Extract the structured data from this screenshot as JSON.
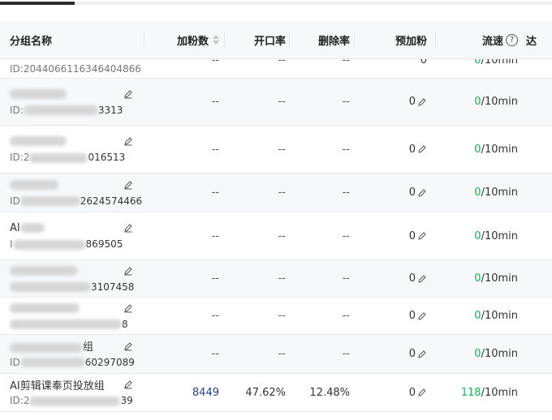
{
  "header": {
    "name": "分组名称",
    "fans": "加粉数",
    "open_rate": "开口率",
    "delete_rate": "删除率",
    "pre_fans": "预加粉",
    "speed": "流速",
    "next": "达"
  },
  "rows": [
    {
      "name": "",
      "id": "ID:2044066116346404866",
      "fans": "--",
      "open": "--",
      "del": "--",
      "pre": "0",
      "speed_num": "0",
      "speed_unit": "/10min"
    },
    {
      "name": "",
      "id": "ID:3313",
      "fans": "--",
      "open": "--",
      "del": "--",
      "pre": "0",
      "speed_num": "0",
      "speed_unit": "/10min"
    },
    {
      "name": "",
      "id": "ID:2016513",
      "fans": "--",
      "open": "--",
      "del": "--",
      "pre": "0",
      "speed_num": "0",
      "speed_unit": "/10min"
    },
    {
      "name": "",
      "id": "ID:2624574466",
      "fans": "--",
      "open": "--",
      "del": "--",
      "pre": "0",
      "speed_num": "0",
      "speed_unit": "/10min"
    },
    {
      "name": "AI",
      "id": "ID:869505",
      "fans": "--",
      "open": "--",
      "del": "--",
      "pre": "0",
      "speed_num": "0",
      "speed_unit": "/10min"
    },
    {
      "name": "",
      "id": "3107458",
      "fans": "--",
      "open": "--",
      "del": "--",
      "pre": "0",
      "speed_num": "0",
      "speed_unit": "/10min"
    },
    {
      "name": "",
      "id": "8",
      "fans": "--",
      "open": "--",
      "del": "--",
      "pre": "0",
      "speed_num": "0",
      "speed_unit": "/10min"
    },
    {
      "name": "组",
      "id": "ID:60297089",
      "fans": "--",
      "open": "--",
      "del": "--",
      "pre": "0",
      "speed_num": "0",
      "speed_unit": "/10min"
    },
    {
      "name": "AI剪辑课奉页投放组",
      "id": "ID:239",
      "fans": "8449",
      "open": "47.62%",
      "del": "12.48%",
      "pre": "0",
      "speed_num": "118",
      "speed_unit": "/10min"
    }
  ]
}
